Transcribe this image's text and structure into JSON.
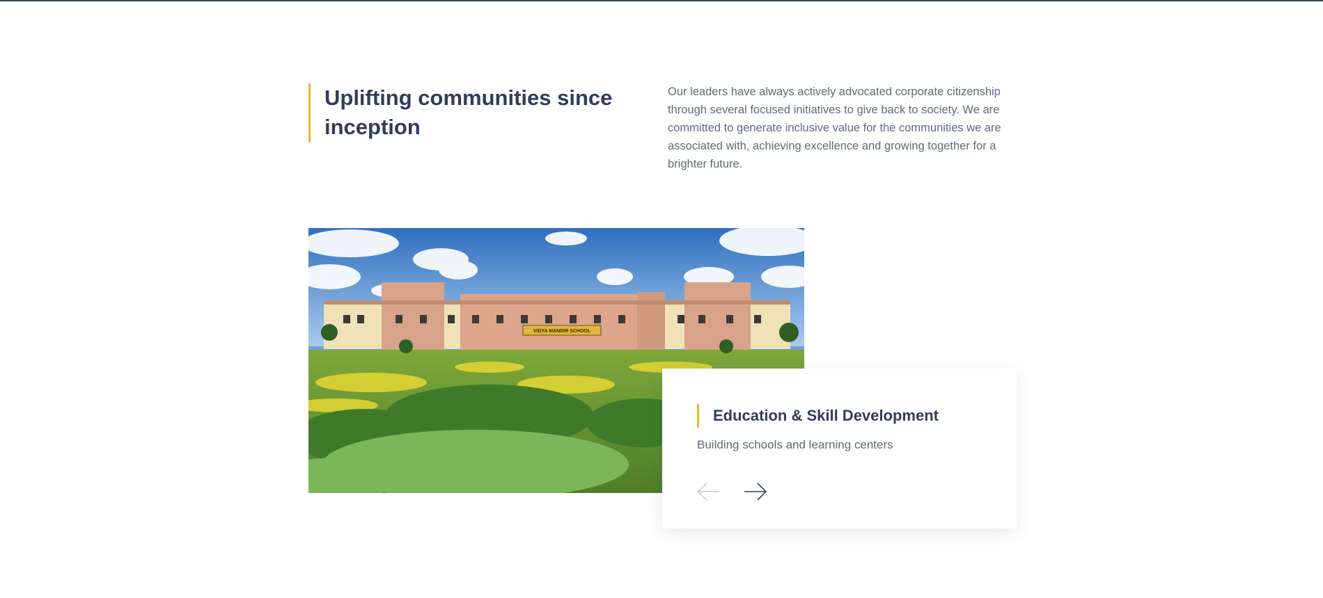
{
  "section": {
    "heading": "Uplifting communities since inception",
    "intro": "Our leaders have always actively advocated corporate citizenship through several focused initiatives to give back to society. We are committed to generate inclusive value for the communities we are associated with, achieving excellence and growing together for a brighter future."
  },
  "photo": {
    "sign_text": "VIDYA MANDIR SCHOOL"
  },
  "slider": {
    "title": "Education & Skill Development",
    "subtitle": "Building schools and learning centers",
    "prev_icon": "arrow-left-icon",
    "next_icon": "arrow-right-icon"
  },
  "colors": {
    "heading": "#2e3e5c",
    "accent": "#f0b429",
    "body_text": "#5e6a80",
    "arrow_disabled": "#c9cdd4",
    "arrow_active": "#2e3e5c"
  }
}
